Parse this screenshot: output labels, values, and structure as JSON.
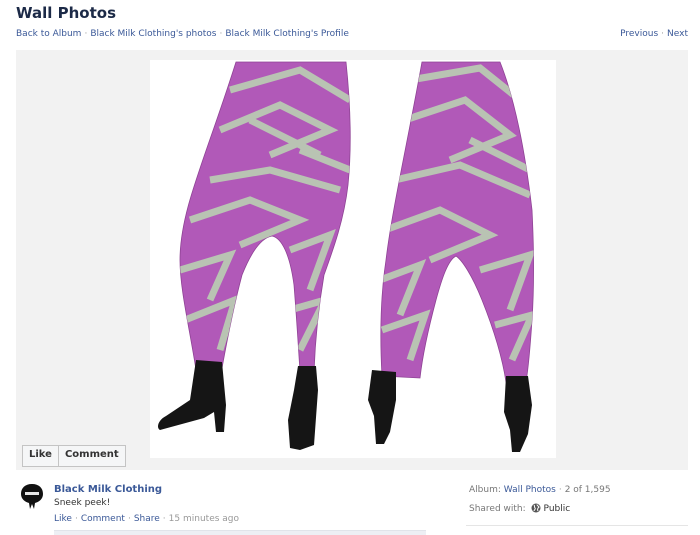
{
  "page": {
    "title": "Wall Photos"
  },
  "breadcrumb": {
    "back": "Back to Album",
    "owner_photos": "Black Milk Clothing's photos",
    "profile": "Black Milk Clothing's Profile",
    "sep": "·"
  },
  "pager": {
    "previous": "Previous",
    "next": "Next"
  },
  "photo_actions": {
    "like": "Like",
    "comment": "Comment"
  },
  "post": {
    "owner": "Black Milk Clothing",
    "caption": "Sneek peek!",
    "like": "Like",
    "comment": "Comment",
    "share": "Share",
    "time": "15 minutes ago"
  },
  "album": {
    "label": "Album:",
    "name": "Wall Photos",
    "position": "2 of 1,595",
    "shared_label": "Shared with:",
    "privacy": "Public"
  },
  "colors": {
    "link": "#3b5998",
    "legging": "#b159b8",
    "stripe": "#b9c3b3"
  },
  "icons": {
    "avatar": "black-milk-logo-icon",
    "privacy": "globe-icon"
  }
}
